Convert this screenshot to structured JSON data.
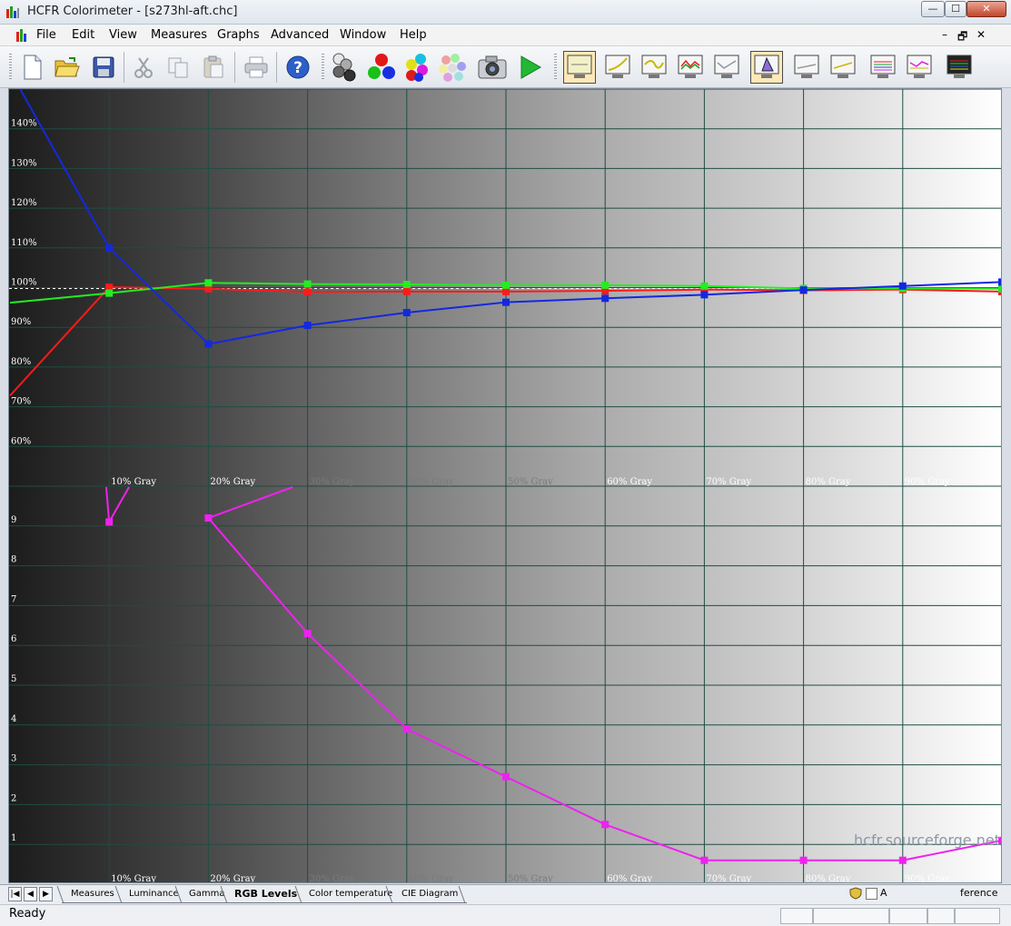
{
  "window": {
    "title": "HCFR Colorimeter - [s273hl-aft.chc]",
    "minimize": "—",
    "maximize": "☐",
    "close": "✕"
  },
  "menu": {
    "items": [
      "File",
      "Edit",
      "View",
      "Measures",
      "Graphs",
      "Advanced",
      "Window",
      "Help"
    ],
    "mdi_restore": "🗗",
    "mdi_close": "✕"
  },
  "toolbar": {
    "buttons": [
      {
        "name": "new-file-icon"
      },
      {
        "name": "open-folder-icon"
      },
      {
        "name": "save-disk-icon"
      },
      {
        "name": "cut-icon"
      },
      {
        "name": "copy-icon"
      },
      {
        "name": "paste-icon"
      },
      {
        "name": "print-icon"
      },
      {
        "name": "help-icon"
      },
      {
        "name": "gray-balls-icon"
      },
      {
        "name": "rgb-balls-icon"
      },
      {
        "name": "secondary-balls-icon"
      },
      {
        "name": "saturation-balls-icon"
      },
      {
        "name": "camera-icon"
      },
      {
        "name": "play-icon"
      },
      {
        "name": "graph-monitor-1-icon"
      },
      {
        "name": "graph-monitor-2-icon"
      },
      {
        "name": "graph-monitor-3-icon"
      },
      {
        "name": "graph-monitor-4-icon"
      },
      {
        "name": "graph-monitor-5-icon"
      },
      {
        "name": "graph-monitor-6-icon"
      },
      {
        "name": "graph-monitor-7-icon"
      },
      {
        "name": "graph-monitor-8-icon"
      },
      {
        "name": "graph-monitor-9-icon"
      },
      {
        "name": "graph-monitor-10-icon"
      },
      {
        "name": "graph-monitor-11-icon"
      }
    ]
  },
  "colors": {
    "red": "#ff1a1a",
    "green": "#22ee22",
    "blue": "#1428e0",
    "magenta": "#ee22ee",
    "grid": "#1f4d44"
  },
  "chart_data": [
    {
      "type": "line",
      "title": "",
      "categories": [
        "10% Gray",
        "20% Gray",
        "30% Gray",
        "40% Gray",
        "50% Gray",
        "60% Gray",
        "70% Gray",
        "80% Gray",
        "90% Gray"
      ],
      "x": [
        0,
        10,
        20,
        30,
        40,
        50,
        60,
        70,
        80,
        90,
        100
      ],
      "y_ticks": [
        "60%",
        "70%",
        "80%",
        "90%",
        "100%",
        "110%",
        "120%",
        "130%",
        "140%"
      ],
      "ylim": [
        50,
        150
      ],
      "series": [
        {
          "color": "red",
          "values": [
            72.8,
            100.1,
            99.7,
            98.9,
            99.0,
            99.0,
            99.2,
            99.5,
            99.3,
            99.5,
            99.0
          ]
        },
        {
          "color": "green",
          "values": [
            96.2,
            98.6,
            101.2,
            100.9,
            100.8,
            100.6,
            100.6,
            100.4,
            99.8,
            99.8,
            99.7
          ]
        },
        {
          "color": "blue",
          "values": [
            200,
            110.0,
            85.8,
            90.5,
            93.7,
            96.3,
            97.3,
            98.2,
            99.4,
            100.4,
            101.4
          ]
        }
      ]
    },
    {
      "type": "line",
      "title": "",
      "categories": [
        "10% Gray",
        "20% Gray",
        "30% Gray",
        "40% Gray",
        "50% Gray",
        "60% Gray",
        "70% Gray",
        "80% Gray",
        "90% Gray"
      ],
      "y_ticks": [
        "1",
        "2",
        "3",
        "4",
        "5",
        "6",
        "7",
        "8",
        "9"
      ],
      "ylim": [
        0,
        10
      ],
      "series": [
        {
          "color": "magenta",
          "x": [
            20,
            30,
            40,
            50,
            60,
            70,
            80,
            90,
            100
          ],
          "values": [
            9.2,
            6.3,
            3.9,
            2.7,
            1.5,
            0.6,
            0.6,
            0.6,
            1.1
          ]
        }
      ]
    }
  ],
  "watermark": "hcfr.sourceforge.net",
  "tabs": {
    "items": [
      "Measures",
      "Luminance",
      "Gamma",
      "RGB Levels",
      "Color temperature",
      "CIE Diagram"
    ],
    "active": "RGB Levels",
    "right_label": "A",
    "right_label2": "ference"
  },
  "status": {
    "text": "Ready"
  }
}
